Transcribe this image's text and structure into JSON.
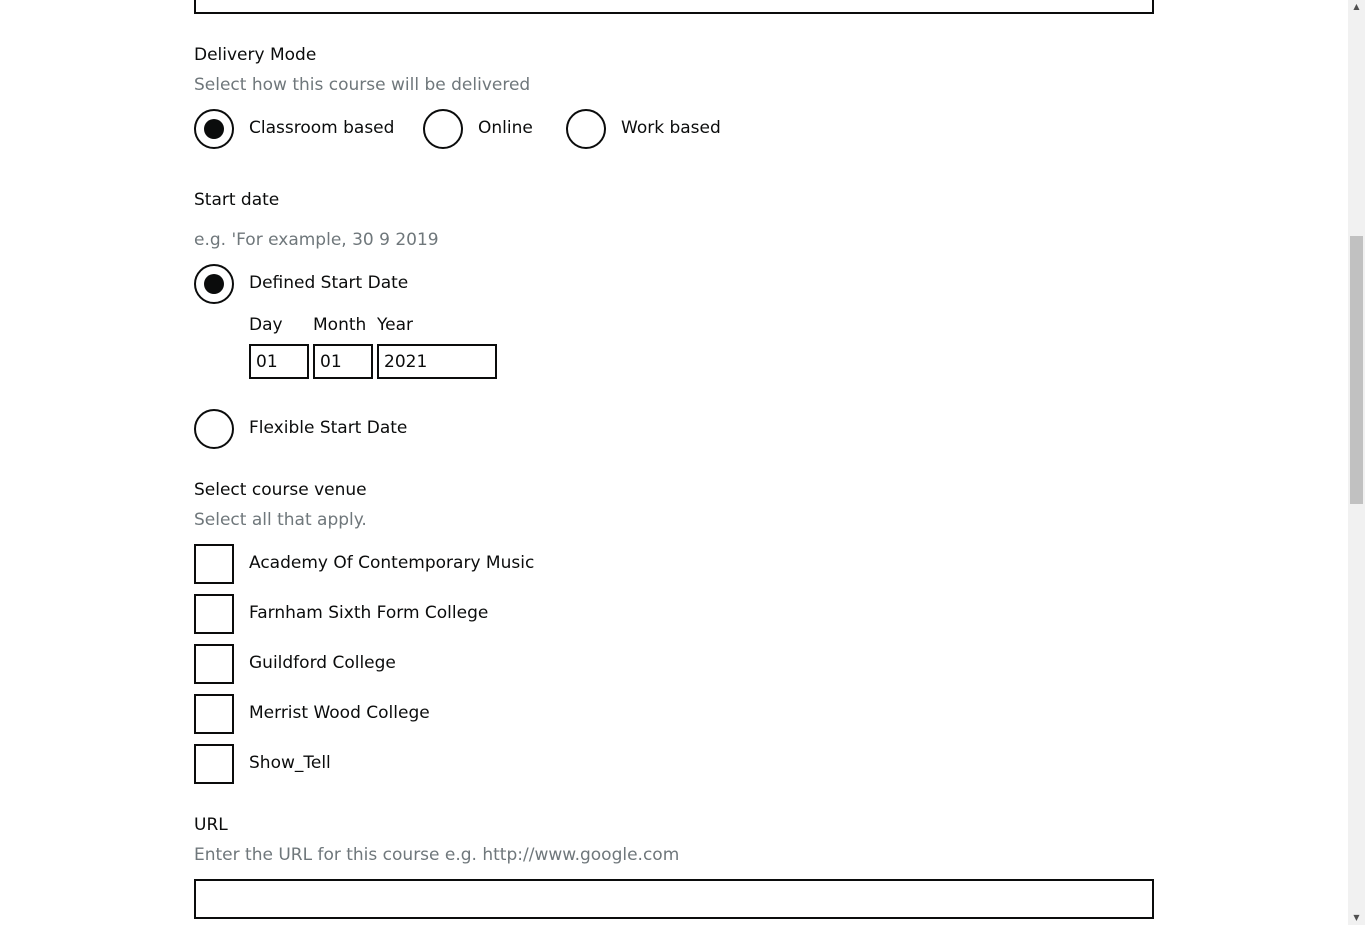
{
  "delivery_mode": {
    "label": "Delivery Mode",
    "hint": "Select how this course will be delivered",
    "options": [
      {
        "label": "Classroom based",
        "checked": true
      },
      {
        "label": "Online",
        "checked": false
      },
      {
        "label": "Work based",
        "checked": false
      }
    ]
  },
  "start_date": {
    "label": "Start date",
    "hint": "e.g. 'For example, 30 9 2019",
    "defined": {
      "label": "Defined Start Date",
      "checked": true
    },
    "day": {
      "label": "Day",
      "value": "01"
    },
    "month": {
      "label": "Month",
      "value": "01"
    },
    "year": {
      "label": "Year",
      "value": "2021"
    },
    "flexible": {
      "label": "Flexible Start Date",
      "checked": false
    }
  },
  "venue": {
    "label": "Select course venue",
    "hint": "Select all that apply.",
    "options": [
      {
        "label": "Academy Of Contemporary Music",
        "checked": false
      },
      {
        "label": "Farnham Sixth Form College",
        "checked": false
      },
      {
        "label": "Guildford College",
        "checked": false
      },
      {
        "label": "Merrist Wood College",
        "checked": false
      },
      {
        "label": "Show_Tell",
        "checked": false
      }
    ]
  },
  "url": {
    "label": "URL",
    "hint": "Enter the URL for this course e.g. http://www.google.com",
    "value": ""
  },
  "icons": {
    "scroll_up": "scroll-up-arrow-icon",
    "scroll_down": "scroll-down-arrow-icon"
  },
  "colors": {
    "text": "#0b0c0c",
    "hint": "#6f777b",
    "border": "#0b0c0c"
  }
}
